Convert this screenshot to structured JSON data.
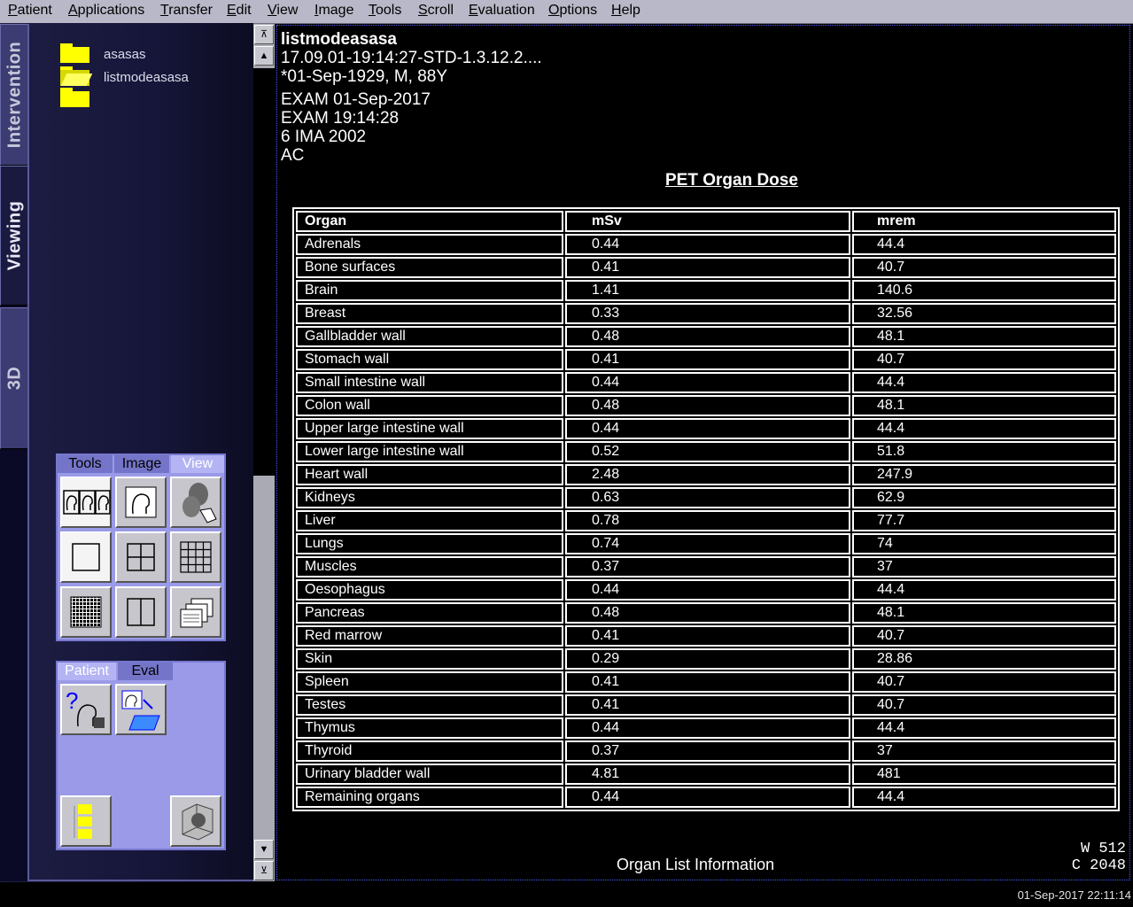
{
  "menu": [
    "Patient",
    "Applications",
    "Transfer",
    "Edit",
    "View",
    "Image",
    "Tools",
    "Scroll",
    "Evaluation",
    "Options",
    "Help"
  ],
  "side_tabs": {
    "intervention": "Intervention",
    "viewing": "Viewing",
    "three_d": "3D"
  },
  "tree": {
    "items": [
      "asasas",
      "listmodeasasa"
    ]
  },
  "view_palette": {
    "tabs": [
      "Tools",
      "Image",
      "View"
    ],
    "active": "View"
  },
  "patient_palette": {
    "tabs": [
      "Patient",
      "Eval"
    ],
    "active": "Patient"
  },
  "header": {
    "line1": "listmodeasasa",
    "line2": "17.09.01-19:14:27-STD-1.3.12.2....",
    "line3": "*01-Sep-1929, M, 88Y",
    "line4": "EXAM 01-Sep-2017",
    "line5": "EXAM 19:14:28",
    "line6": "6 IMA 2002",
    "line7": "AC"
  },
  "report": {
    "title": "PET Organ Dose",
    "columns": [
      "Organ",
      "mSv",
      "mrem"
    ],
    "rows": [
      [
        "Adrenals",
        "0.44",
        "44.4"
      ],
      [
        "Bone surfaces",
        "0.41",
        "40.7"
      ],
      [
        "Brain",
        "1.41",
        "140.6"
      ],
      [
        "Breast",
        "0.33",
        "32.56"
      ],
      [
        "Gallbladder wall",
        "0.48",
        "48.1"
      ],
      [
        "Stomach wall",
        "0.41",
        "40.7"
      ],
      [
        "Small intestine wall",
        "0.44",
        "44.4"
      ],
      [
        "Colon wall",
        "0.48",
        "48.1"
      ],
      [
        "Upper large intestine wall",
        "0.44",
        "44.4"
      ],
      [
        "Lower large intestine wall",
        "0.52",
        "51.8"
      ],
      [
        "Heart wall",
        "2.48",
        "247.9"
      ],
      [
        "Kidneys",
        "0.63",
        "62.9"
      ],
      [
        "Liver",
        "0.78",
        "77.7"
      ],
      [
        "Lungs",
        "0.74",
        "74"
      ],
      [
        "Muscles",
        "0.37",
        "37"
      ],
      [
        "Oesophagus",
        "0.44",
        "44.4"
      ],
      [
        "Pancreas",
        "0.48",
        "48.1"
      ],
      [
        "Red marrow",
        "0.41",
        "40.7"
      ],
      [
        "Skin",
        "0.29",
        "28.86"
      ],
      [
        "Spleen",
        "0.41",
        "40.7"
      ],
      [
        "Testes",
        "0.41",
        "40.7"
      ],
      [
        "Thymus",
        "0.44",
        "44.4"
      ],
      [
        "Thyroid",
        "0.37",
        "37"
      ],
      [
        "Urinary bladder wall",
        "4.81",
        "481"
      ],
      [
        "Remaining organs",
        "0.44",
        "44.4"
      ]
    ],
    "footer": "Organ List Information"
  },
  "window_level": {
    "w": "W   512",
    "c": "C  2048"
  },
  "status": {
    "datetime": "01-Sep-2017 22:11:14"
  },
  "colors": {
    "menu_bg": "#b8b8c8",
    "palette_bg": "#9a9ae8",
    "folder": "#ffff00",
    "viewer_border": "#4a5aff"
  }
}
